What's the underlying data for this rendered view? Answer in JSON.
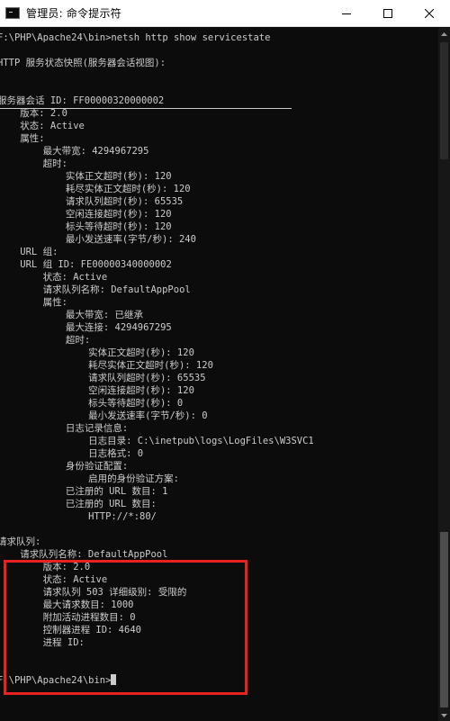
{
  "window": {
    "title": "管理员: 命令提示符",
    "icon": "terminal-icon",
    "controls": [
      "minimize-icon",
      "maximize-icon",
      "close-icon"
    ]
  },
  "console": {
    "lines": [
      "F:\\PHP\\Apache24\\bin>netsh http show servicestate",
      "",
      "HTTP 服务状态快照(服务器会话视图):",
      "",
      "",
      "服务器会话 ID: FF00000320000002",
      "    版本: 2.0",
      "    状态: Active",
      "    属性:",
      "        最大带宽: 4294967295",
      "        超时:",
      "            实体正文超时(秒): 120",
      "            耗尽实体正文超时(秒): 120",
      "            请求队列超时(秒): 65535",
      "            空闲连接超时(秒): 120",
      "            标头等待超时(秒): 120",
      "            最小发送速率(字节/秒): 240",
      "    URL 组:",
      "    URL 组 ID: FE00000340000002",
      "        状态: Active",
      "        请求队列名称: DefaultAppPool",
      "        属性:",
      "            最大带宽: 已继承",
      "            最大连接: 4294967295",
      "            超时:",
      "                实体正文超时(秒): 120",
      "                耗尽实体正文超时(秒): 120",
      "                请求队列超时(秒): 65535",
      "                空闲连接超时(秒): 120",
      "                标头等待超时(秒): 0",
      "                最小发送速率(字节/秒): 0",
      "            日志记录信息:",
      "                日志目录: C:\\inetpub\\logs\\LogFiles\\W3SVC1",
      "                日志格式: 0",
      "            身份验证配置:",
      "                启用的身份验证方案:",
      "            已注册的 URL 数目: 1",
      "            已注册的 URL 数目:",
      "                HTTP://*:80/",
      "",
      "请求队列:",
      "    请求队列名称: DefaultAppPool",
      "        版本: 2.0",
      "        状态: Active",
      "        请求队列 503 详细级别: 受限的",
      "        最大请求数目: 1000",
      "        附加活动进程数目: 0",
      "        控制器进程 ID: 4640",
      "        进程 ID:",
      "",
      "",
      "F:\\PHP\\Apache24\\bin>"
    ]
  },
  "colors": {
    "console_bg": "#0c0c0c",
    "console_text": "#cccccc",
    "highlight_border": "#e8221f"
  }
}
